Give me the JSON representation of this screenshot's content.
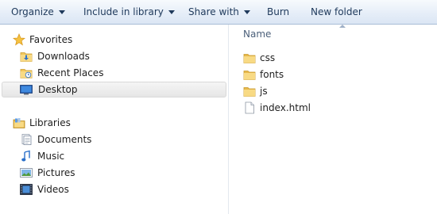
{
  "toolbar": {
    "organize": "Organize",
    "include_in_library": "Include in library",
    "share_with": "Share with",
    "burn": "Burn",
    "new_folder": "New folder"
  },
  "nav": {
    "favorites": {
      "label": "Favorites",
      "items": [
        {
          "label": "Downloads",
          "icon": "downloads-folder-icon"
        },
        {
          "label": "Recent Places",
          "icon": "recent-places-icon"
        },
        {
          "label": "Desktop",
          "icon": "desktop-icon",
          "selected": true
        }
      ]
    },
    "libraries": {
      "label": "Libraries",
      "items": [
        {
          "label": "Documents",
          "icon": "documents-icon"
        },
        {
          "label": "Music",
          "icon": "music-icon"
        },
        {
          "label": "Pictures",
          "icon": "pictures-icon"
        },
        {
          "label": "Videos",
          "icon": "videos-icon"
        }
      ]
    }
  },
  "content": {
    "column_name": "Name",
    "files": [
      {
        "name": "css",
        "type": "folder"
      },
      {
        "name": "fonts",
        "type": "folder"
      },
      {
        "name": "js",
        "type": "folder"
      },
      {
        "name": "index.html",
        "type": "file"
      }
    ]
  },
  "colors": {
    "toolbar_text": "#1e395b",
    "folder_yellow": "#f2c75c",
    "header_text": "#4c607a"
  }
}
